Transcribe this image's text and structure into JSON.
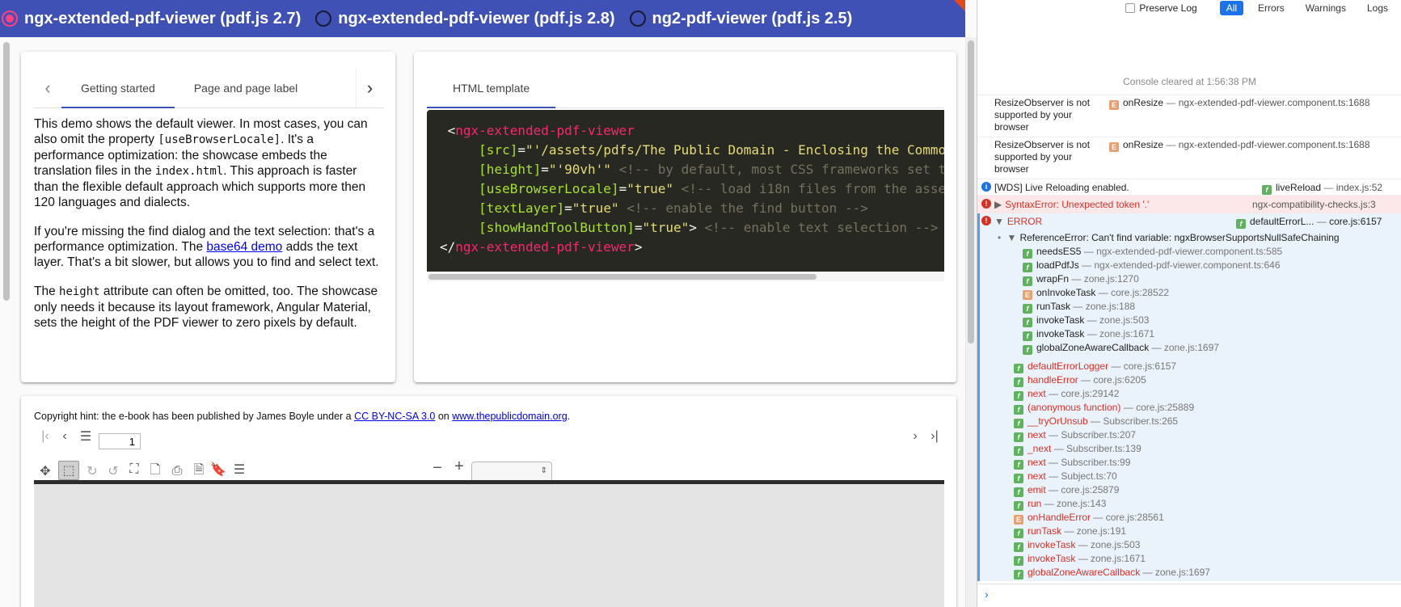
{
  "topbar": {
    "options": [
      {
        "label": "ngx-extended-pdf-viewer (pdf.js 2.7)",
        "selected": true
      },
      {
        "label": "ngx-extended-pdf-viewer (pdf.js 2.8)",
        "selected": false
      },
      {
        "label": "ng2-pdf-viewer (pdf.js 2.5)",
        "selected": false
      }
    ]
  },
  "card1": {
    "tabs": [
      "Getting started",
      "Page and page label"
    ],
    "p1_a": "This demo shows the default viewer. In most cases, you can also omit the property ",
    "p1_code1": "[useBrowserLocale]",
    "p1_b": ". It's a performance optimization: the showcase embeds the translation files in the ",
    "p1_code2": "index.html",
    "p1_c": ". This approach is faster than the flexible default approach which supports more then 120 languages and dialects.",
    "p2_a": "If you're missing the find dialog and the text selection: that's a performance optimization. The ",
    "p2_link": "base64 demo",
    "p2_b": " adds the text layer. That's a bit slower, but allows you to find and select text.",
    "p3_a": "The ",
    "p3_code": "height",
    "p3_b": " attribute can often be omitted, too. The showcase only needs it because its layout framework, Angular Material, sets the height of the PDF viewer to zero pixels by default."
  },
  "card2": {
    "tab": "HTML template",
    "code": {
      "open_tag": "ngx-extended-pdf-viewer",
      "l1_attr": "[src]",
      "l1_val": "\"'/assets/pdfs/The Public Domain - Enclosing the Commo",
      "l2_attr": "[height]",
      "l2_val": "\"'90vh'\"",
      "l2_cmt": "<!-- by default, most CSS frameworks set t",
      "l3_attr": "[useBrowserLocale]",
      "l3_val": "\"true\"",
      "l3_cmt": "<!-- load i18n files from the asse",
      "l4_attr": "[textLayer]",
      "l4_val": "\"true\"",
      "l4_cmt": "<!-- enable the find button -->",
      "l5_attr": "[showHandToolButton]",
      "l5_val": "\"true\"",
      "l5_cmt": "<!-- enable text selection -->",
      "close_tag": "ngx-extended-pdf-viewer"
    }
  },
  "card3": {
    "hint_a": "Copyright hint: the e-book has been published by James Boyle under a ",
    "hint_link1": "CC BY-NC-SA 3.0",
    "hint_b": " on ",
    "hint_link2": "www.thepublicdomain.org",
    "hint_c": ".",
    "page_number": "1"
  },
  "console": {
    "preserve_log": "Preserve Log",
    "filters": [
      "All",
      "Errors",
      "Warnings",
      "Logs"
    ],
    "cleared": "Console cleared at 1:56:38 PM",
    "resize1_text": "ResizeObserver is not supported by your browser",
    "resize1_fn": "onResize",
    "resize1_src": "ngx-extended-pdf-viewer.component.ts:1688",
    "resize2_text": "ResizeObserver is not supported by your browser",
    "resize2_fn": "onResize",
    "resize2_src": "ngx-extended-pdf-viewer.component.ts:1688",
    "wds_text": "[WDS] Live Reloading enabled.",
    "wds_fn": "liveReload",
    "wds_src": "index.js:52",
    "syntax_text": "SyntaxError: Unexpected token '.'",
    "syntax_src": "ngx-compatibility-checks.js:3",
    "error_label": "ERROR",
    "error_fn": "defaultErrorL...",
    "error_src": "core.js:6157",
    "ref_error": "ReferenceError: Can't find variable: ngxBrowserSupportsNullSafeChaining",
    "inner_trace": [
      {
        "fn": "needsES5",
        "src": "ngx-extended-pdf-viewer.component.ts:585",
        "badge": "f"
      },
      {
        "fn": "loadPdfJs",
        "src": "ngx-extended-pdf-viewer.component.ts:646",
        "badge": "f"
      },
      {
        "fn": "wrapFn",
        "src": "zone.js:1270",
        "badge": "f"
      },
      {
        "fn": "onInvokeTask",
        "src": "core.js:28522",
        "badge": "E"
      },
      {
        "fn": "runTask",
        "src": "zone.js:188",
        "badge": "f"
      },
      {
        "fn": "invokeTask",
        "src": "zone.js:503",
        "badge": "f"
      },
      {
        "fn": "invokeTask",
        "src": "zone.js:1671",
        "badge": "f"
      },
      {
        "fn": "globalZoneAwareCallback",
        "src": "zone.js:1697",
        "badge": "f"
      }
    ],
    "outer_trace": [
      {
        "fn": "defaultErrorLogger",
        "src": "core.js:6157",
        "badge": "f"
      },
      {
        "fn": "handleError",
        "src": "core.js:6205",
        "badge": "f"
      },
      {
        "fn": "next",
        "src": "core.js:29142",
        "badge": "f"
      },
      {
        "fn": "(anonymous function)",
        "src": "core.js:25889",
        "badge": "f"
      },
      {
        "fn": "__tryOrUnsub",
        "src": "Subscriber.ts:265",
        "badge": "f"
      },
      {
        "fn": "next",
        "src": "Subscriber.ts:207",
        "badge": "f"
      },
      {
        "fn": "_next",
        "src": "Subscriber.ts:139",
        "badge": "f"
      },
      {
        "fn": "next",
        "src": "Subscriber.ts:99",
        "badge": "f"
      },
      {
        "fn": "next",
        "src": "Subject.ts:70",
        "badge": "f"
      },
      {
        "fn": "emit",
        "src": "core.js:25879",
        "badge": "f"
      },
      {
        "fn": "run",
        "src": "zone.js:143",
        "badge": "f"
      },
      {
        "fn": "onHandleError",
        "src": "core.js:28561",
        "badge": "E"
      },
      {
        "fn": "runTask",
        "src": "zone.js:191",
        "badge": "f"
      },
      {
        "fn": "invokeTask",
        "src": "zone.js:503",
        "badge": "f"
      },
      {
        "fn": "invokeTask",
        "src": "zone.js:1671",
        "badge": "f"
      },
      {
        "fn": "globalZoneAwareCallback",
        "src": "zone.js:1697",
        "badge": "f"
      }
    ],
    "prompt": "›"
  },
  "colors": {
    "toolbar": "#3f51b5",
    "accent": "#ff4081",
    "console_error": "#d93025",
    "console_link": "#1a73e8"
  }
}
